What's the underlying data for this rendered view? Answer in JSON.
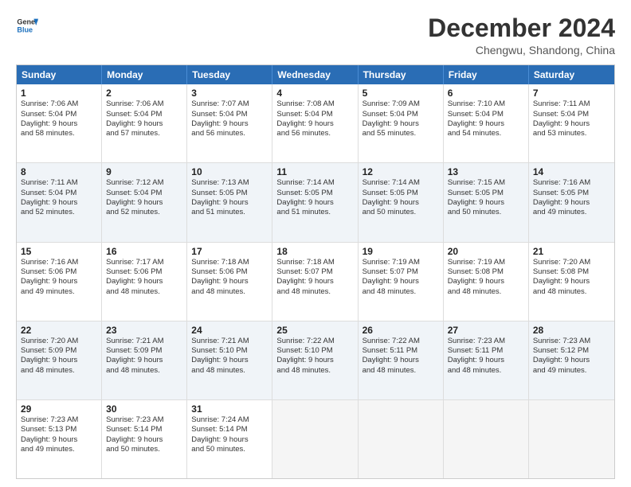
{
  "header": {
    "logo_line1": "General",
    "logo_line2": "Blue",
    "month_year": "December 2024",
    "location": "Chengwu, Shandong, China"
  },
  "weekdays": [
    "Sunday",
    "Monday",
    "Tuesday",
    "Wednesday",
    "Thursday",
    "Friday",
    "Saturday"
  ],
  "rows": [
    [
      {
        "day": "1",
        "lines": [
          "Sunrise: 7:06 AM",
          "Sunset: 5:04 PM",
          "Daylight: 9 hours",
          "and 58 minutes."
        ]
      },
      {
        "day": "2",
        "lines": [
          "Sunrise: 7:06 AM",
          "Sunset: 5:04 PM",
          "Daylight: 9 hours",
          "and 57 minutes."
        ]
      },
      {
        "day": "3",
        "lines": [
          "Sunrise: 7:07 AM",
          "Sunset: 5:04 PM",
          "Daylight: 9 hours",
          "and 56 minutes."
        ]
      },
      {
        "day": "4",
        "lines": [
          "Sunrise: 7:08 AM",
          "Sunset: 5:04 PM",
          "Daylight: 9 hours",
          "and 56 minutes."
        ]
      },
      {
        "day": "5",
        "lines": [
          "Sunrise: 7:09 AM",
          "Sunset: 5:04 PM",
          "Daylight: 9 hours",
          "and 55 minutes."
        ]
      },
      {
        "day": "6",
        "lines": [
          "Sunrise: 7:10 AM",
          "Sunset: 5:04 PM",
          "Daylight: 9 hours",
          "and 54 minutes."
        ]
      },
      {
        "day": "7",
        "lines": [
          "Sunrise: 7:11 AM",
          "Sunset: 5:04 PM",
          "Daylight: 9 hours",
          "and 53 minutes."
        ]
      }
    ],
    [
      {
        "day": "8",
        "lines": [
          "Sunrise: 7:11 AM",
          "Sunset: 5:04 PM",
          "Daylight: 9 hours",
          "and 52 minutes."
        ]
      },
      {
        "day": "9",
        "lines": [
          "Sunrise: 7:12 AM",
          "Sunset: 5:04 PM",
          "Daylight: 9 hours",
          "and 52 minutes."
        ]
      },
      {
        "day": "10",
        "lines": [
          "Sunrise: 7:13 AM",
          "Sunset: 5:05 PM",
          "Daylight: 9 hours",
          "and 51 minutes."
        ]
      },
      {
        "day": "11",
        "lines": [
          "Sunrise: 7:14 AM",
          "Sunset: 5:05 PM",
          "Daylight: 9 hours",
          "and 51 minutes."
        ]
      },
      {
        "day": "12",
        "lines": [
          "Sunrise: 7:14 AM",
          "Sunset: 5:05 PM",
          "Daylight: 9 hours",
          "and 50 minutes."
        ]
      },
      {
        "day": "13",
        "lines": [
          "Sunrise: 7:15 AM",
          "Sunset: 5:05 PM",
          "Daylight: 9 hours",
          "and 50 minutes."
        ]
      },
      {
        "day": "14",
        "lines": [
          "Sunrise: 7:16 AM",
          "Sunset: 5:05 PM",
          "Daylight: 9 hours",
          "and 49 minutes."
        ]
      }
    ],
    [
      {
        "day": "15",
        "lines": [
          "Sunrise: 7:16 AM",
          "Sunset: 5:06 PM",
          "Daylight: 9 hours",
          "and 49 minutes."
        ]
      },
      {
        "day": "16",
        "lines": [
          "Sunrise: 7:17 AM",
          "Sunset: 5:06 PM",
          "Daylight: 9 hours",
          "and 48 minutes."
        ]
      },
      {
        "day": "17",
        "lines": [
          "Sunrise: 7:18 AM",
          "Sunset: 5:06 PM",
          "Daylight: 9 hours",
          "and 48 minutes."
        ]
      },
      {
        "day": "18",
        "lines": [
          "Sunrise: 7:18 AM",
          "Sunset: 5:07 PM",
          "Daylight: 9 hours",
          "and 48 minutes."
        ]
      },
      {
        "day": "19",
        "lines": [
          "Sunrise: 7:19 AM",
          "Sunset: 5:07 PM",
          "Daylight: 9 hours",
          "and 48 minutes."
        ]
      },
      {
        "day": "20",
        "lines": [
          "Sunrise: 7:19 AM",
          "Sunset: 5:08 PM",
          "Daylight: 9 hours",
          "and 48 minutes."
        ]
      },
      {
        "day": "21",
        "lines": [
          "Sunrise: 7:20 AM",
          "Sunset: 5:08 PM",
          "Daylight: 9 hours",
          "and 48 minutes."
        ]
      }
    ],
    [
      {
        "day": "22",
        "lines": [
          "Sunrise: 7:20 AM",
          "Sunset: 5:09 PM",
          "Daylight: 9 hours",
          "and 48 minutes."
        ]
      },
      {
        "day": "23",
        "lines": [
          "Sunrise: 7:21 AM",
          "Sunset: 5:09 PM",
          "Daylight: 9 hours",
          "and 48 minutes."
        ]
      },
      {
        "day": "24",
        "lines": [
          "Sunrise: 7:21 AM",
          "Sunset: 5:10 PM",
          "Daylight: 9 hours",
          "and 48 minutes."
        ]
      },
      {
        "day": "25",
        "lines": [
          "Sunrise: 7:22 AM",
          "Sunset: 5:10 PM",
          "Daylight: 9 hours",
          "and 48 minutes."
        ]
      },
      {
        "day": "26",
        "lines": [
          "Sunrise: 7:22 AM",
          "Sunset: 5:11 PM",
          "Daylight: 9 hours",
          "and 48 minutes."
        ]
      },
      {
        "day": "27",
        "lines": [
          "Sunrise: 7:23 AM",
          "Sunset: 5:11 PM",
          "Daylight: 9 hours",
          "and 48 minutes."
        ]
      },
      {
        "day": "28",
        "lines": [
          "Sunrise: 7:23 AM",
          "Sunset: 5:12 PM",
          "Daylight: 9 hours",
          "and 49 minutes."
        ]
      }
    ],
    [
      {
        "day": "29",
        "lines": [
          "Sunrise: 7:23 AM",
          "Sunset: 5:13 PM",
          "Daylight: 9 hours",
          "and 49 minutes."
        ]
      },
      {
        "day": "30",
        "lines": [
          "Sunrise: 7:23 AM",
          "Sunset: 5:14 PM",
          "Daylight: 9 hours",
          "and 50 minutes."
        ]
      },
      {
        "day": "31",
        "lines": [
          "Sunrise: 7:24 AM",
          "Sunset: 5:14 PM",
          "Daylight: 9 hours",
          "and 50 minutes."
        ]
      },
      {
        "day": "",
        "lines": []
      },
      {
        "day": "",
        "lines": []
      },
      {
        "day": "",
        "lines": []
      },
      {
        "day": "",
        "lines": []
      }
    ]
  ]
}
